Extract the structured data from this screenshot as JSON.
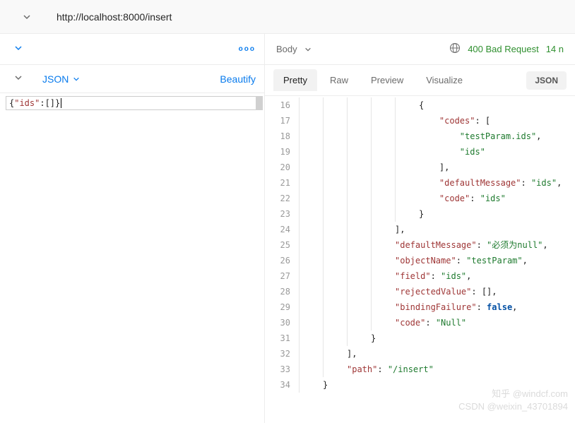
{
  "url": "http://localhost:8000/insert",
  "left": {
    "json_label": "JSON",
    "beautify": "Beautify",
    "body_text": "{\"ids\":[]}"
  },
  "response": {
    "body_label": "Body",
    "status_code": "400",
    "status_text": "Bad Request",
    "time": "14 n",
    "tabs": {
      "pretty": "Pretty",
      "raw": "Raw",
      "preview": "Preview",
      "visualize": "Visualize"
    },
    "format": "JSON",
    "lines": [
      {
        "num": "16",
        "indent": 5,
        "tokens": [
          [
            "p",
            "{"
          ]
        ]
      },
      {
        "num": "17",
        "indent": 5,
        "tokens": [
          [
            "p",
            "    "
          ],
          [
            "k",
            "\"codes\""
          ],
          [
            "p",
            ": ["
          ]
        ]
      },
      {
        "num": "18",
        "indent": 5,
        "tokens": [
          [
            "p",
            "        "
          ],
          [
            "s",
            "\"testParam.ids\""
          ],
          [
            "p",
            ","
          ]
        ]
      },
      {
        "num": "19",
        "indent": 5,
        "tokens": [
          [
            "p",
            "        "
          ],
          [
            "s",
            "\"ids\""
          ]
        ]
      },
      {
        "num": "20",
        "indent": 5,
        "tokens": [
          [
            "p",
            "    ],"
          ]
        ]
      },
      {
        "num": "21",
        "indent": 5,
        "tokens": [
          [
            "p",
            "    "
          ],
          [
            "k",
            "\"defaultMessage\""
          ],
          [
            "p",
            ": "
          ],
          [
            "s",
            "\"ids\""
          ],
          [
            "p",
            ","
          ]
        ]
      },
      {
        "num": "22",
        "indent": 5,
        "tokens": [
          [
            "p",
            "    "
          ],
          [
            "k",
            "\"code\""
          ],
          [
            "p",
            ": "
          ],
          [
            "s",
            "\"ids\""
          ]
        ]
      },
      {
        "num": "23",
        "indent": 5,
        "tokens": [
          [
            "p",
            "}"
          ]
        ]
      },
      {
        "num": "24",
        "indent": 4,
        "tokens": [
          [
            "p",
            "],"
          ]
        ]
      },
      {
        "num": "25",
        "indent": 4,
        "tokens": [
          [
            "k",
            "\"defaultMessage\""
          ],
          [
            "p",
            ": "
          ],
          [
            "s",
            "\"必须为null\""
          ],
          [
            "p",
            ","
          ]
        ]
      },
      {
        "num": "26",
        "indent": 4,
        "tokens": [
          [
            "k",
            "\"objectName\""
          ],
          [
            "p",
            ": "
          ],
          [
            "s",
            "\"testParam\""
          ],
          [
            "p",
            ","
          ]
        ]
      },
      {
        "num": "27",
        "indent": 4,
        "tokens": [
          [
            "k",
            "\"field\""
          ],
          [
            "p",
            ": "
          ],
          [
            "s",
            "\"ids\""
          ],
          [
            "p",
            ","
          ]
        ]
      },
      {
        "num": "28",
        "indent": 4,
        "tokens": [
          [
            "k",
            "\"rejectedValue\""
          ],
          [
            "p",
            ": [],"
          ]
        ]
      },
      {
        "num": "29",
        "indent": 4,
        "tokens": [
          [
            "k",
            "\"bindingFailure\""
          ],
          [
            "p",
            ": "
          ],
          [
            "b",
            "false"
          ],
          [
            "p",
            ","
          ]
        ]
      },
      {
        "num": "30",
        "indent": 4,
        "tokens": [
          [
            "k",
            "\"code\""
          ],
          [
            "p",
            ": "
          ],
          [
            "s",
            "\"Null\""
          ]
        ]
      },
      {
        "num": "31",
        "indent": 3,
        "tokens": [
          [
            "p",
            "}"
          ]
        ]
      },
      {
        "num": "32",
        "indent": 2,
        "tokens": [
          [
            "p",
            "],"
          ]
        ]
      },
      {
        "num": "33",
        "indent": 2,
        "tokens": [
          [
            "k",
            "\"path\""
          ],
          [
            "p",
            ": "
          ],
          [
            "s",
            "\"/insert\""
          ]
        ]
      },
      {
        "num": "34",
        "indent": 1,
        "tokens": [
          [
            "p",
            "}"
          ]
        ]
      }
    ]
  },
  "watermark": {
    "l1": "知乎 @windcf.com",
    "l2": "CSDN @weixin_43701894"
  }
}
